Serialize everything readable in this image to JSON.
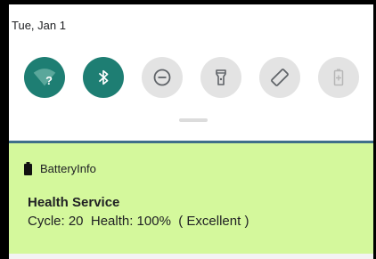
{
  "status": {
    "date": "Tue, Jan 1"
  },
  "quick_settings": {
    "tiles": [
      {
        "name": "wifi",
        "state": "on",
        "icon": "wifi-unknown-icon"
      },
      {
        "name": "bluetooth",
        "state": "on",
        "icon": "bluetooth-icon"
      },
      {
        "name": "do-not-disturb",
        "state": "off",
        "icon": "do-not-disturb-icon"
      },
      {
        "name": "flashlight",
        "state": "off",
        "icon": "flashlight-icon"
      },
      {
        "name": "auto-rotate",
        "state": "off",
        "icon": "auto-rotate-icon"
      },
      {
        "name": "battery-saver",
        "state": "off",
        "icon": "battery-saver-icon"
      }
    ],
    "colors": {
      "on": "#1e7e73",
      "off": "#e3e3e3"
    }
  },
  "notification": {
    "app_name": "BatteryInfo",
    "app_icon": "battery-icon",
    "title": "Health Service",
    "text": "Cycle: 20  Health: 100%  ( Excellent )",
    "background": "#d4f89c"
  }
}
